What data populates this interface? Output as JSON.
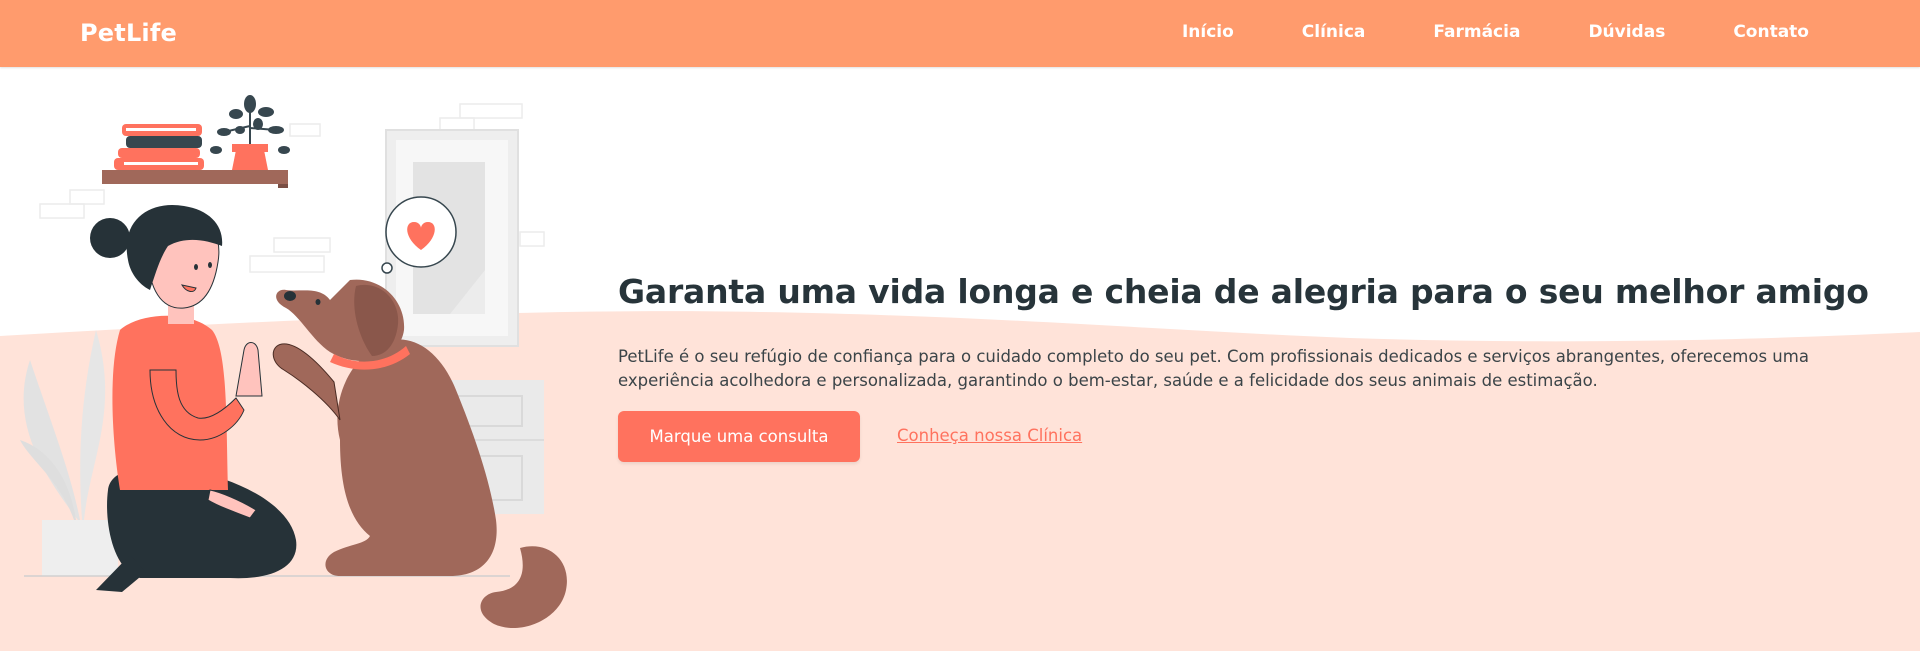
{
  "brand": {
    "name": "PetLife"
  },
  "nav": {
    "links": [
      "Início",
      "Clínica",
      "Farmácia",
      "Dúvidas",
      "Contato"
    ]
  },
  "hero": {
    "title": "Garanta uma vida longa e cheia de alegria para o seu melhor amigo",
    "description": "PetLife é o seu refúgio de confiança para o cuidado completo do seu pet. Com profissionais dedicados e serviços abrangentes, oferecemos uma experiência acolhedora e personalizada, garantindo o bem-estar, saúde e a felicidade dos seus animais de estimação.",
    "primary_cta": "Marque uma consulta",
    "secondary_cta": "Conheça nossa Clínica"
  },
  "colors": {
    "navbar": "#ff9b6d",
    "accent": "#ff725e",
    "wave_background": "#ffe3d9",
    "heading": "#27343a"
  },
  "icons": {
    "illustration": "woman-high-five-dog-illustration",
    "speech_bubble": "heart-icon"
  }
}
